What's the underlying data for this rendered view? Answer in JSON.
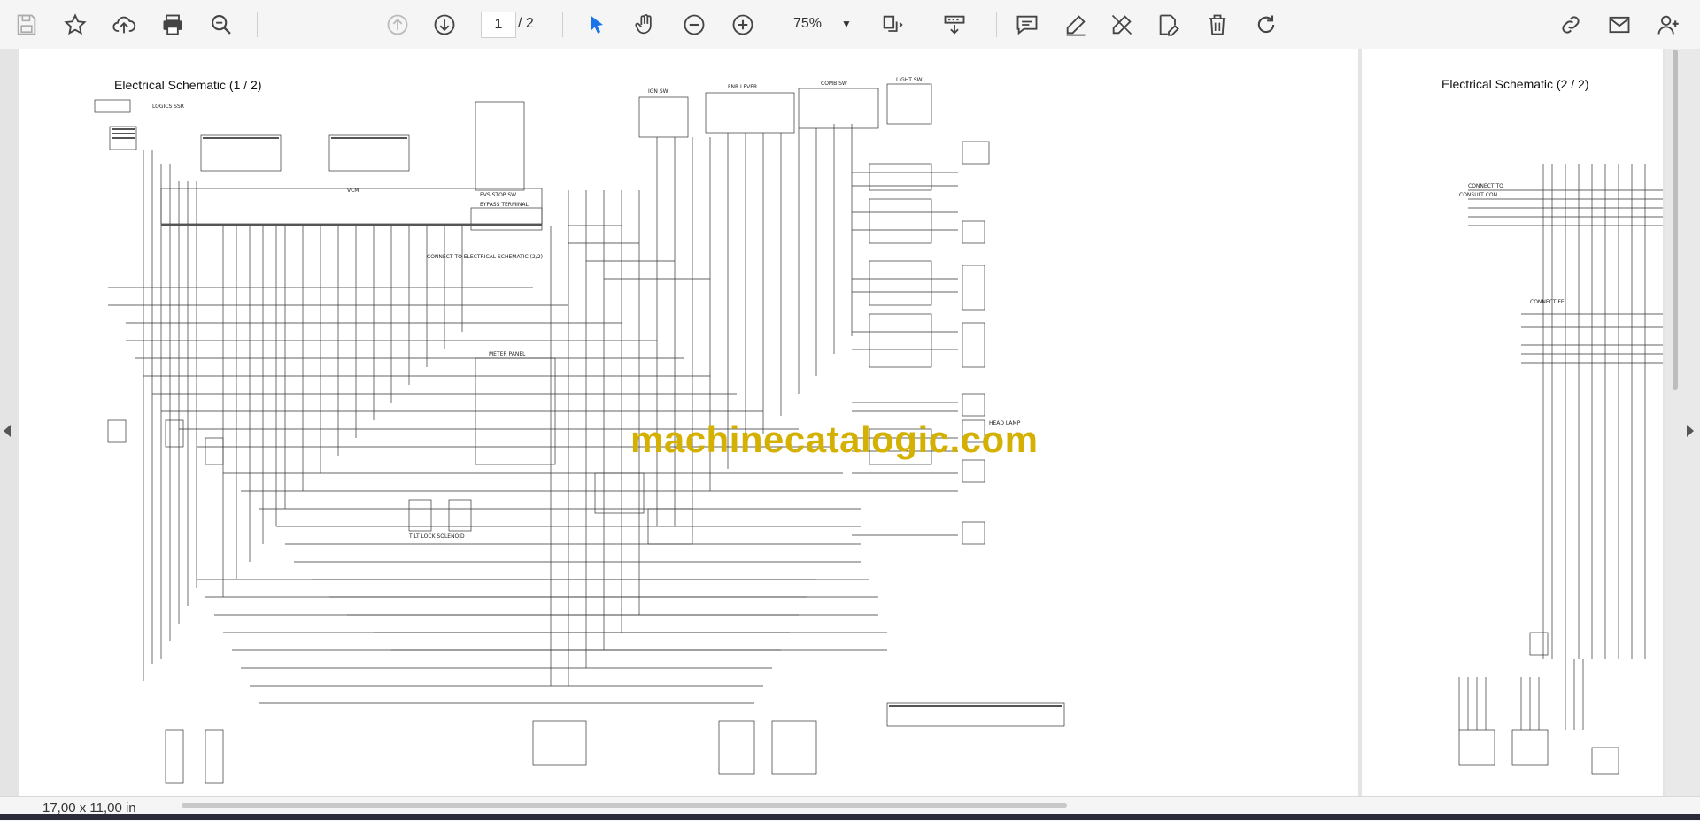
{
  "toolbar": {
    "save": "save-icon",
    "bookmark": "star-icon",
    "upload": "cloud-upload-icon",
    "print": "printer-icon",
    "find": "zoom-search-icon",
    "prev_page": "arrow-up-circle-icon",
    "next_page": "arrow-down-circle-icon",
    "current_page": "1",
    "total_pages": "/ 2",
    "select_tool": "cursor-icon",
    "hand_tool": "hand-icon",
    "zoom_out": "zoom-out-icon",
    "zoom_in": "zoom-in-icon",
    "zoom_value": "75%",
    "fit": "fit-page-icon",
    "scroll_mode": "scroll-mode-icon",
    "comment": "comment-icon",
    "highlight": "pen-icon",
    "draw": "draw-icon",
    "edit_text": "edit-text-icon",
    "delete": "trash-icon",
    "rotate": "rotate-icon",
    "share": "share-link-icon",
    "email": "email-icon",
    "add_user": "add-user-icon"
  },
  "document": {
    "page1_title": "Electrical Schematic (1 / 2)",
    "page2_title": "Electrical Schematic (2 / 2)",
    "watermark": "machinecatalogic.com",
    "labels": {
      "logic": "LOGICS SSR",
      "vcm": "VCM",
      "evs": "EVS STOP SW",
      "bypass": "BYPASS TERMINAL",
      "ign": "IGN SW",
      "fnr": "FNR LEVER",
      "comb": "COMB SW",
      "light": "LIGHT SW",
      "connect": "CONNECT TO ELECTRICAL SCHEMATIC (2/2)",
      "meter": "METER PANEL",
      "tilt_lock": "TILT LOCK SOLENOID",
      "head_lamp": "HEAD LAMP",
      "connect_to": "CONNECT TO",
      "consult": "CONSULT CON",
      "connect_fe": "CONNECT FE"
    }
  },
  "status": {
    "dimensions": "17,00 x 11,00 in"
  },
  "colors": {
    "toolbar_bg": "#f5f5f5",
    "accent": "#1a73e8",
    "watermark": "#d4b000"
  }
}
